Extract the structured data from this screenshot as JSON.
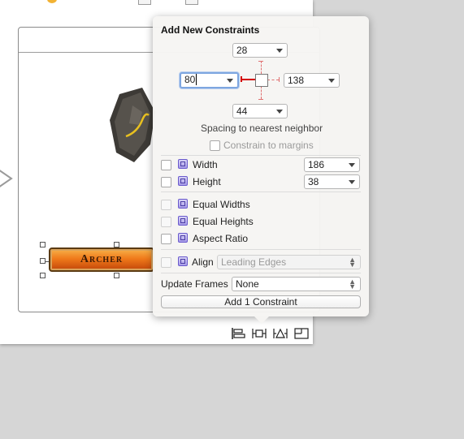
{
  "popover": {
    "title": "Add New Constraints",
    "top_value": "28",
    "left_value": "80",
    "right_value": "138",
    "bottom_value": "44",
    "spacing_caption": "Spacing to nearest neighbor",
    "constrain_margins_label": "Constrain to margins",
    "constrain_margins_checked": false,
    "width": {
      "label": "Width",
      "value": "186",
      "checked": false,
      "icon": "width-constraint-icon"
    },
    "height": {
      "label": "Height",
      "value": "38",
      "checked": false,
      "icon": "height-constraint-icon"
    },
    "equal_widths": {
      "label": "Equal Widths",
      "checked": false,
      "enabled": false
    },
    "equal_heights": {
      "label": "Equal Heights",
      "checked": false,
      "enabled": false
    },
    "aspect_ratio": {
      "label": "Aspect Ratio",
      "checked": false,
      "enabled": true
    },
    "align": {
      "label": "Align",
      "value": "Leading Edges",
      "checked": false,
      "enabled": false
    },
    "update_frames_label": "Update Frames",
    "update_frames_value": "None",
    "add_button_label": "Add 1 Constraint"
  },
  "canvas": {
    "button_title": "Archer"
  },
  "toolbar": {
    "items": [
      "align-icon",
      "pin-icon",
      "resolve-issues-icon",
      "resizing-icon"
    ]
  },
  "colors": {
    "accent_focus": "#7ea6e0",
    "strut_active": "#d40000",
    "strut_inactive": "#e07070",
    "archer_orange": "#f07a1a"
  }
}
